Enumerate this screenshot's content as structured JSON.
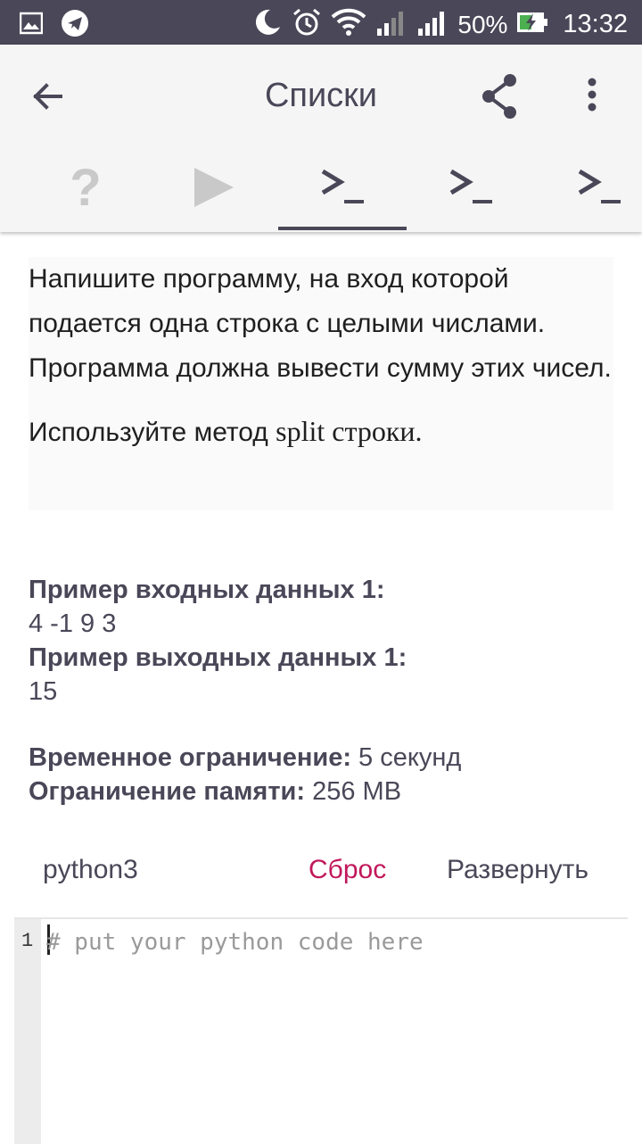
{
  "status_bar": {
    "battery": "50%",
    "time": "13:32",
    "icons": [
      "image-icon",
      "telegram-icon",
      "moon-icon",
      "alarm-icon",
      "wifi-icon",
      "signal-icon",
      "signal-icon",
      "battery-charging-icon"
    ]
  },
  "app_bar": {
    "title": "Списки",
    "back_icon": "arrow-back-icon",
    "share_icon": "share-icon",
    "more_icon": "more-vert-icon"
  },
  "tabs": [
    {
      "icon": "question-icon",
      "active": false
    },
    {
      "icon": "play-icon",
      "active": false
    },
    {
      "icon": "terminal-icon",
      "active": true
    },
    {
      "icon": "terminal-icon",
      "active": false
    },
    {
      "icon": "terminal-icon",
      "active": false
    }
  ],
  "problem": {
    "paragraph1": "Напишите программу, на вход которой подается одна строка с целыми числами. Программа должна вывести сумму этих чисел.",
    "paragraph2_prefix": "Используйте метод ",
    "paragraph2_code": "split",
    "paragraph2_suffix": " строки."
  },
  "samples": {
    "input_label": "Пример входных данных 1:",
    "input_value": "4 -1 9 3",
    "output_label": "Пример выходных данных 1:",
    "output_value": "15"
  },
  "limits": {
    "time_label": "Временное ограничение:",
    "time_value": " 5 секунд",
    "memory_label": "Ограничение памяти:",
    "memory_value": " 256 MB"
  },
  "editor": {
    "language": "python3",
    "reset_label": "Сброс",
    "expand_label": "Развернуть",
    "line_number": "1",
    "placeholder": "# put your python code here",
    "value": ""
  },
  "colors": {
    "status_bar": "#4a4758",
    "accent": "#4a4758",
    "reset": "#c2185b"
  }
}
